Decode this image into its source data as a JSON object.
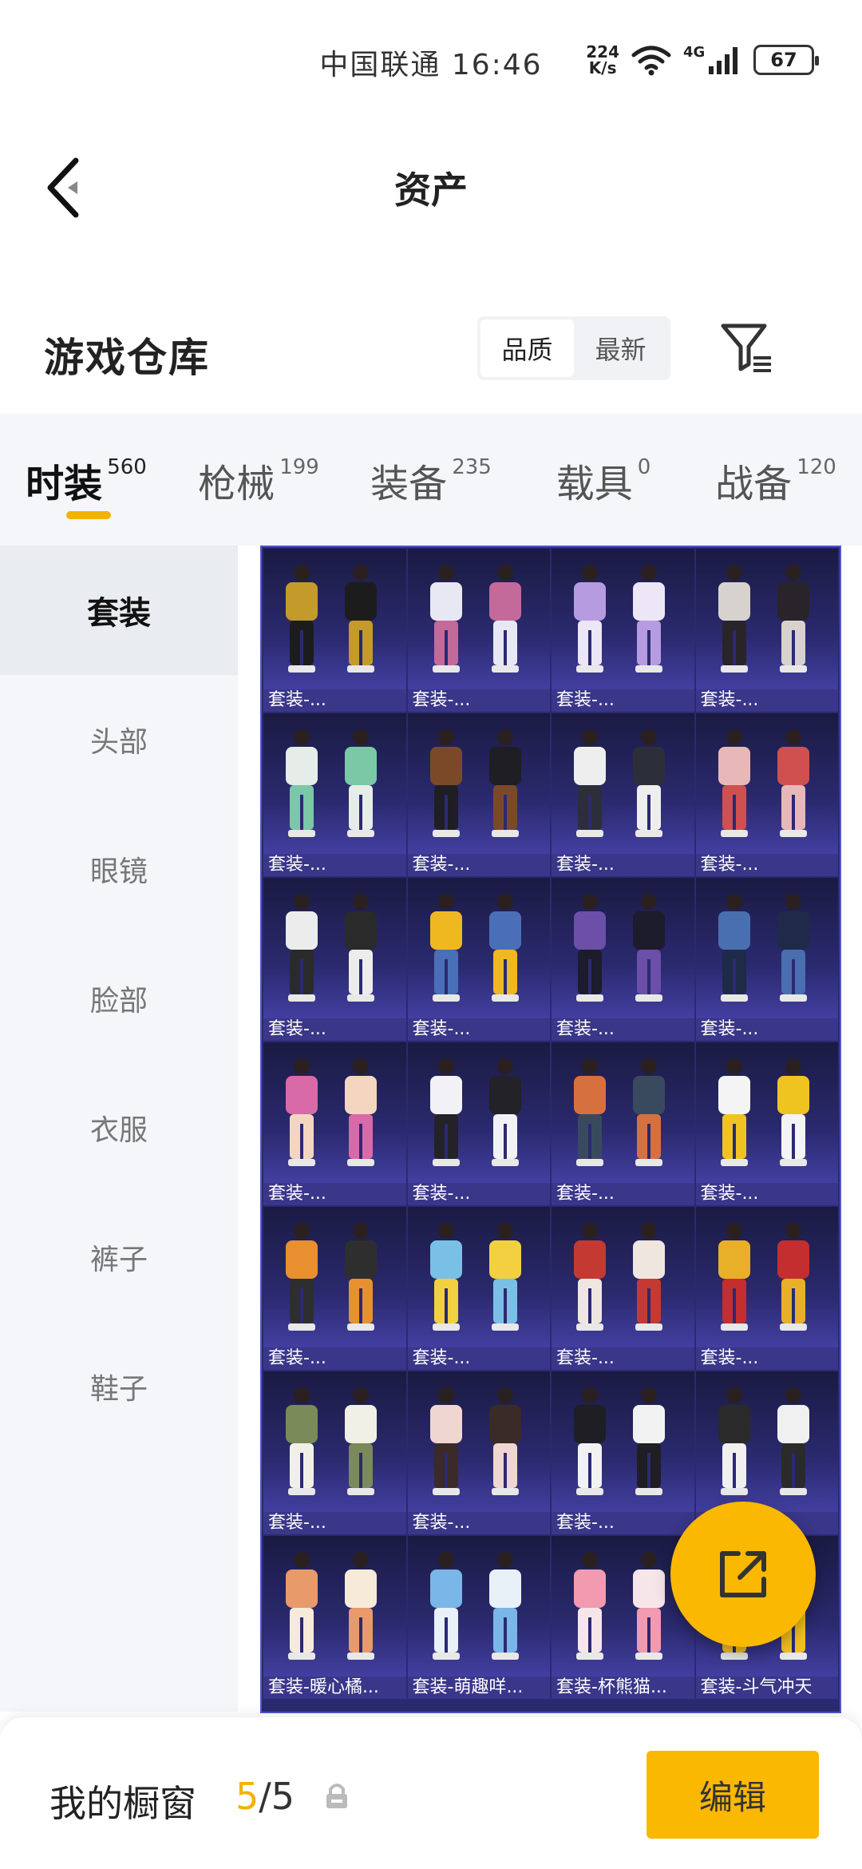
{
  "status_bar": {
    "carrier_time": "中国联通 16:46",
    "net_speed_value": "224",
    "net_speed_unit": "K/s",
    "network": "4G",
    "battery": "67"
  },
  "header": {
    "title": "资产",
    "back_icon": "chevron-left-icon"
  },
  "warehouse": {
    "title": "游戏仓库",
    "sort_options": [
      "品质",
      "最新"
    ],
    "active_sort": "品质",
    "filter_icon": "filter-icon"
  },
  "tabs": [
    {
      "label": "时装",
      "count": "560",
      "active": true
    },
    {
      "label": "枪械",
      "count": "199",
      "active": false
    },
    {
      "label": "装备",
      "count": "235",
      "active": false
    },
    {
      "label": "载具",
      "count": "0",
      "active": false
    },
    {
      "label": "战备",
      "count": "120",
      "active": false
    }
  ],
  "sidebar": {
    "items": [
      "套装",
      "头部",
      "眼镜",
      "脸部",
      "衣服",
      "裤子",
      "鞋子"
    ],
    "active": "套装"
  },
  "grid": {
    "items": [
      {
        "label": "套装-...",
        "colors": [
          "#c49a2a",
          "#1c1c1c"
        ]
      },
      {
        "label": "套装-...",
        "colors": [
          "#e8e8f4",
          "#c46a9a"
        ]
      },
      {
        "label": "套装-...",
        "colors": [
          "#b79be0",
          "#ece6f6"
        ]
      },
      {
        "label": "套装-...",
        "colors": [
          "#d8d2cf",
          "#28242a"
        ]
      },
      {
        "label": "套装-...",
        "colors": [
          "#e6ece8",
          "#7ac8a6"
        ]
      },
      {
        "label": "套装-...",
        "colors": [
          "#7a4a28",
          "#1e1e24"
        ]
      },
      {
        "label": "套装-...",
        "colors": [
          "#eeeeee",
          "#2c2f3a"
        ]
      },
      {
        "label": "套装-...",
        "colors": [
          "#e8b8b8",
          "#d05050"
        ]
      },
      {
        "label": "套装-...",
        "colors": [
          "#ececec",
          "#2a2a2a"
        ]
      },
      {
        "label": "套装-...",
        "colors": [
          "#f0b820",
          "#4a6fb8"
        ]
      },
      {
        "label": "套装-...",
        "colors": [
          "#6b4fa8",
          "#1c1c2c"
        ]
      },
      {
        "label": "套装-...",
        "colors": [
          "#4a6fb0",
          "#1e2a48"
        ]
      },
      {
        "label": "套装-...",
        "colors": [
          "#d86aa8",
          "#f4d6c0"
        ]
      },
      {
        "label": "套装-...",
        "colors": [
          "#f2f2f6",
          "#222228"
        ]
      },
      {
        "label": "套装-...",
        "colors": [
          "#d6713f",
          "#3a4a5e"
        ]
      },
      {
        "label": "套装-...",
        "colors": [
          "#f4f4f4",
          "#f0c420"
        ]
      },
      {
        "label": "套装-...",
        "colors": [
          "#e89030",
          "#2e2e2e"
        ]
      },
      {
        "label": "套装-...",
        "colors": [
          "#7ac0e6",
          "#f2d040"
        ]
      },
      {
        "label": "套装-...",
        "colors": [
          "#c43a32",
          "#f0e6e0"
        ]
      },
      {
        "label": "套装-...",
        "colors": [
          "#e8b028",
          "#c42e2e"
        ]
      },
      {
        "label": "套装-...",
        "colors": [
          "#7a8a58",
          "#f0f0e6"
        ]
      },
      {
        "label": "套装-...",
        "colors": [
          "#f0d6d0",
          "#3a2a28"
        ]
      },
      {
        "label": "套装-...",
        "colors": [
          "#1e1e24",
          "#f2f2f2"
        ]
      },
      {
        "label": "套装-...",
        "colors": [
          "#2a2a2a",
          "#f0f0f0"
        ]
      },
      {
        "label": "套装-暖心橘...",
        "colors": [
          "#e89a6a",
          "#f6ead8"
        ]
      },
      {
        "label": "套装-萌趣咩...",
        "colors": [
          "#7ab6e8",
          "#e8f0f8"
        ]
      },
      {
        "label": "套装-杯熊猫...",
        "colors": [
          "#f29ab0",
          "#f6e6ea"
        ]
      },
      {
        "label": "套装-斗气冲天",
        "colors": [
          "#f4c020",
          "#f4c020"
        ]
      }
    ]
  },
  "fab": {
    "icon": "share-external-icon"
  },
  "bottom_bar": {
    "wardrobe_label": "我的橱窗",
    "current": "5",
    "separator_total": "/5",
    "lock_icon": "lock-icon",
    "edit_label": "编辑"
  }
}
